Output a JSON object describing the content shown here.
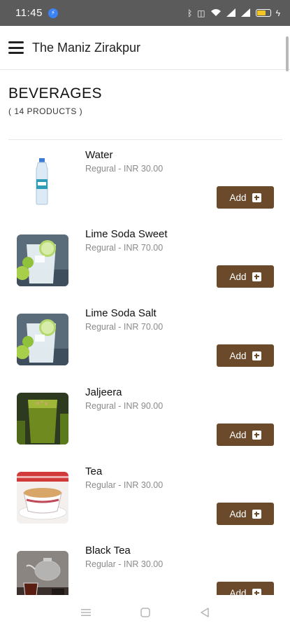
{
  "status_bar": {
    "time": "11:45",
    "icons": [
      "messenger-icon",
      "bluetooth-icon",
      "vibrate-icon",
      "wifi-icon",
      "signal-icon",
      "signal-icon",
      "battery-icon"
    ]
  },
  "app_bar": {
    "title": "The Maniz Zirakpur",
    "menu_icon": "hamburger-menu-icon"
  },
  "category": {
    "title": "BEVERAGES",
    "count": "( 14 PRODUCTS )"
  },
  "products": [
    {
      "name": "Water",
      "variant": "Regural",
      "price": "INR 30.00",
      "button": "Add",
      "image": "water-bottle"
    },
    {
      "name": "Lime Soda Sweet",
      "variant": "Regural",
      "price": "INR 70.00",
      "button": "Add",
      "image": "lime-soda"
    },
    {
      "name": "Lime Soda Salt",
      "variant": "Regural",
      "price": "INR 70.00",
      "button": "Add",
      "image": "lime-soda"
    },
    {
      "name": "Jaljeera",
      "variant": "Regural",
      "price": "INR 90.00",
      "button": "Add",
      "image": "jaljeera-glass"
    },
    {
      "name": "Tea",
      "variant": "Regular",
      "price": "INR 30.00",
      "button": "Add",
      "image": "tea-cup"
    },
    {
      "name": "Black Tea",
      "variant": "Regular",
      "price": "INR 30.00",
      "button": "Add",
      "image": "black-tea"
    }
  ],
  "nav_bar": {
    "items": [
      "recents-icon",
      "home-icon",
      "back-icon"
    ]
  },
  "colors": {
    "accent": "#6b4a2b",
    "status_bar": "#5b5b5b",
    "muted_text": "#8a8a8a"
  }
}
